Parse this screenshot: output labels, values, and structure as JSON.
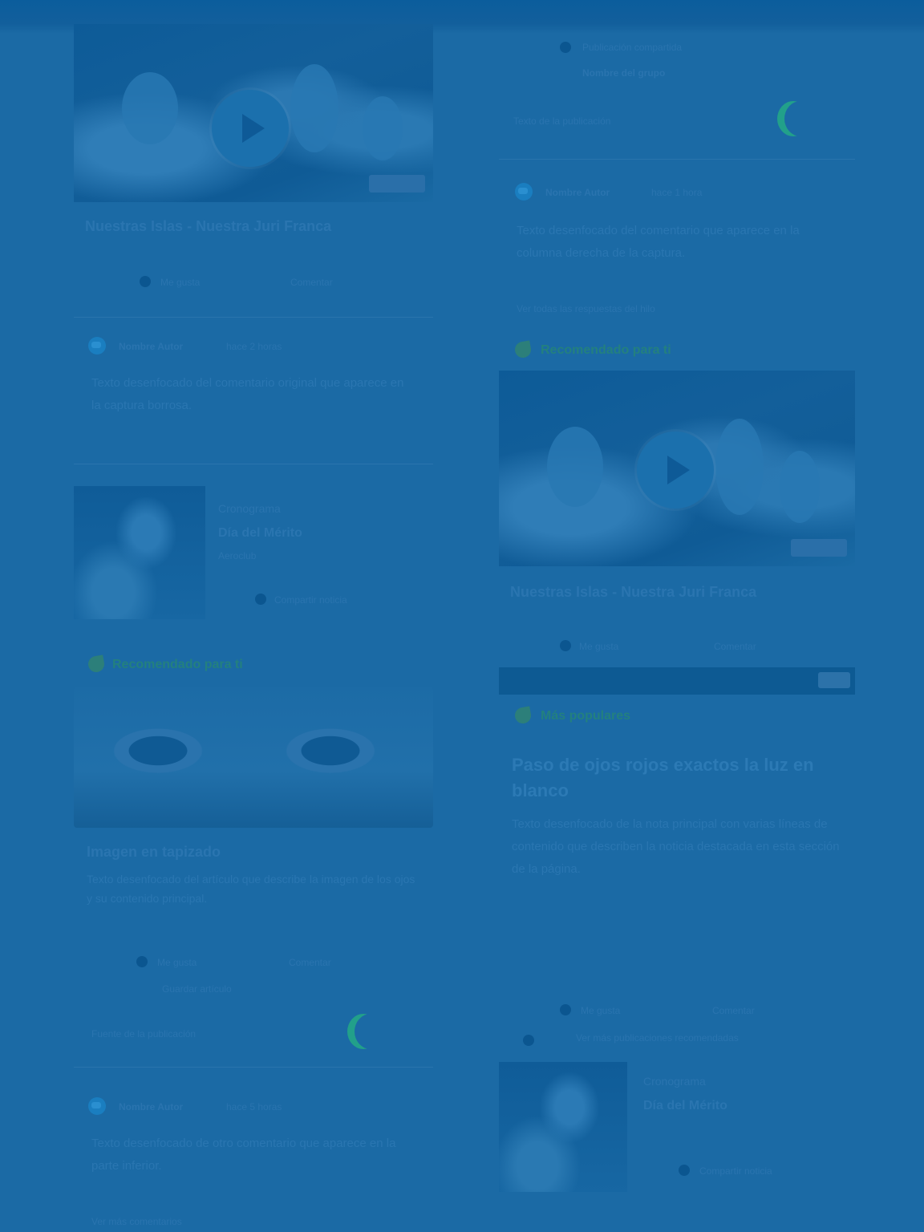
{
  "left": {
    "video1": {
      "title": "Nuestras Islas - Nuestra Juri Franca",
      "like": "Me gusta",
      "comment": "Comentar"
    },
    "post1": {
      "author": "Nombre Autor",
      "time": "hace 2 horas",
      "text": "Texto desenfocado del comentario original que aparece en la captura borrosa."
    },
    "news1": {
      "kicker": "Cronograma",
      "title": "Día del Mérito",
      "sub": "Aeroclub",
      "link": "Compartir noticia"
    },
    "section_label": "Recomendado para ti",
    "article": {
      "title": "Imagen en tapizado",
      "text": "Texto desenfocado del artículo que describe la imagen de los ojos y su contenido principal.",
      "like": "Me gusta",
      "comment": "Comentar",
      "extra": "Guardar artículo",
      "source": "Fuente de la publicación"
    },
    "post2": {
      "author": "Nombre Autor",
      "time": "hace 5 horas",
      "text": "Texto desenfocado de otro comentario que aparece en la parte inferior.",
      "footer": "Ver más comentarios"
    }
  },
  "right": {
    "top": {
      "meta": "Publicación compartida",
      "meta2": "Nombre del grupo",
      "caption": "Texto de la publicación"
    },
    "post1": {
      "author": "Nombre Autor",
      "time": "hace 1 hora",
      "text": "Texto desenfocado del comentario que aparece en la columna derecha de la captura.",
      "footer": "Ver todas las respuestas del hilo"
    },
    "section_label": "Recomendado para ti",
    "video2": {
      "title": "Nuestras Islas - Nuestra Juri Franca",
      "like": "Me gusta",
      "comment": "Comentar"
    },
    "label2": "Más populares",
    "article": {
      "title": "Paso de ojos rojos exactos la luz en blanco",
      "text": "Texto desenfocado de la nota principal con varias líneas de contenido que describen la noticia destacada en esta sección de la página.",
      "like": "Me gusta",
      "comment": "Comentar",
      "extra": "Ver más publicaciones recomendadas"
    },
    "news2": {
      "kicker": "Cronograma",
      "title": "Día del Mérito",
      "link": "Compartir noticia"
    }
  }
}
